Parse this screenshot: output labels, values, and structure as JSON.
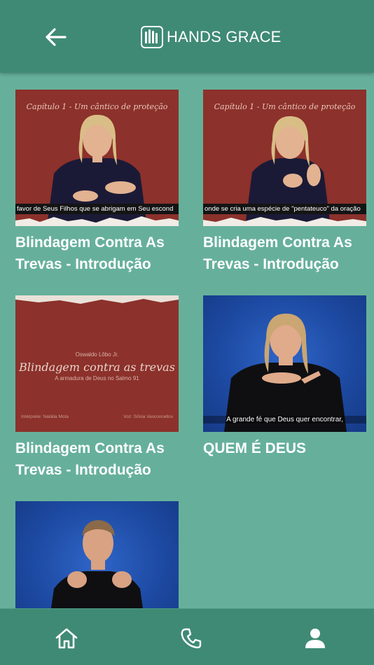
{
  "app_bar": {
    "back_icon": "arrow-left-icon",
    "brand_name": "HANDS GRACE",
    "brand_logo_icon": "raised-hands-logo"
  },
  "videos": [
    {
      "title": "Blindagem Contra As Trevas - Introdução",
      "thumb_heading": "Capítulo 1 - Um cântico de proteção",
      "thumb_caption": "favor de Seus Filhos que se abrigam em Seu escond"
    },
    {
      "title": "Blindagem Contra As Trevas - Introdução",
      "thumb_heading": "Capítulo 1 - Um cântico de proteção",
      "thumb_caption": "onde se cria uma espécie de \"pentateuco\" da oração"
    },
    {
      "title": "Blindagem Contra As Trevas - Introdução",
      "thumb_author": "Oswaldo Lôbo Jr.",
      "thumb_heading": "Blindagem contra as trevas",
      "thumb_subheading": "A armadura de Deus no Salmo 91",
      "thumb_credit_left": "Intérprete: Natália Mota",
      "thumb_credit_right": "Voz: Sônia Vasconcellos"
    },
    {
      "title": "QUEM É DEUS",
      "thumb_caption": "A grande fé que Deus quer encontrar,"
    },
    {
      "title": "",
      "thumb_caption": ""
    }
  ],
  "bottom_nav": {
    "home_icon": "home-icon",
    "phone_icon": "phone-icon",
    "profile_icon": "user-icon"
  },
  "colors": {
    "background": "#66b09b",
    "app_bar": "#3f8a74",
    "thumb_red": "#8c312b",
    "thumb_blue": "#1d4aa3",
    "text": "#ffffff"
  }
}
